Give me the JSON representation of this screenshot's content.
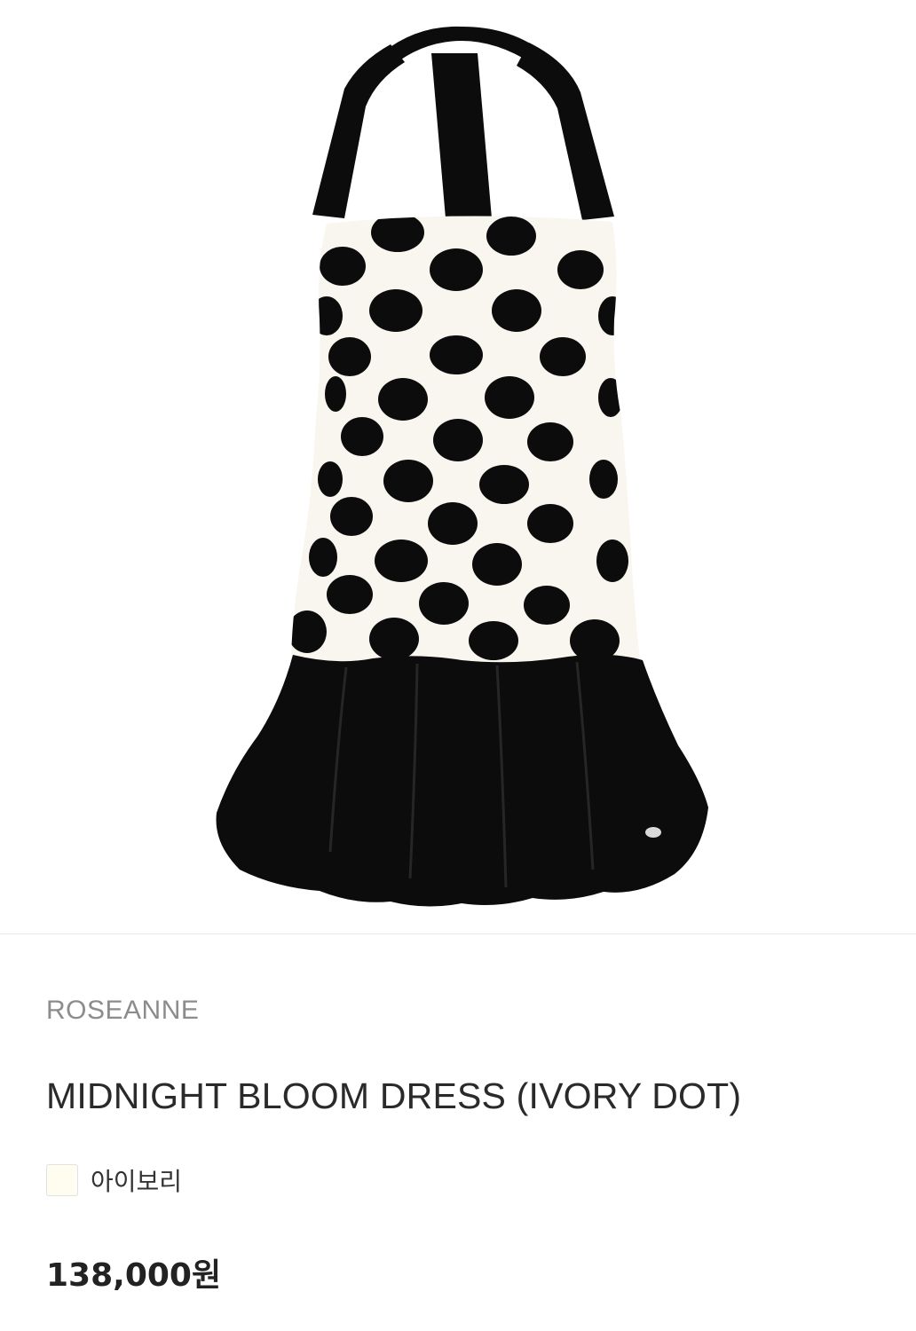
{
  "product": {
    "image_alt": "polka-dot halter dress",
    "brand": "ROSEANNE",
    "name": "MIDNIGHT BLOOM DRESS (IVORY DOT)",
    "color": {
      "name": "아이보리",
      "swatch_hex": "#fffdf0"
    },
    "price": {
      "amount": "138,000",
      "unit": "원"
    }
  },
  "colors": {
    "dress_ivory": "#f8f6ee",
    "dress_black": "#0c0c0c",
    "text_primary": "#2a2a2a",
    "text_muted": "#8c8c8c"
  }
}
